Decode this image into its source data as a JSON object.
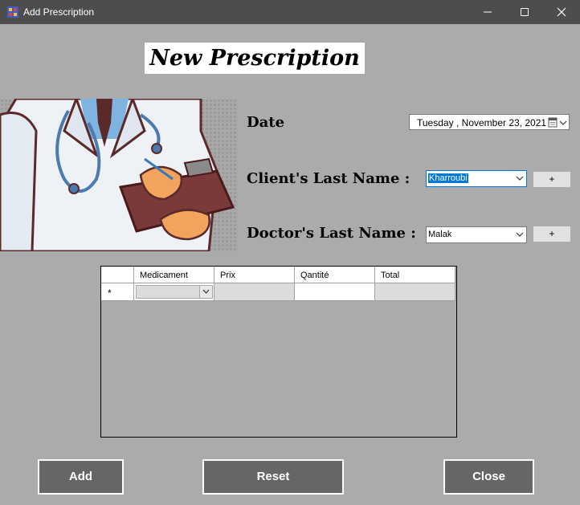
{
  "window": {
    "title": "Add Prescription",
    "controls": {
      "minimize": "minimize-icon",
      "maximize": "maximize-icon",
      "close": "close-icon"
    }
  },
  "header": {
    "title": "New Prescription"
  },
  "form": {
    "date_label": "Date",
    "date_day": "Tuesday",
    "date_value": ", November 23, 2021",
    "client_label": "Client's Last Name :",
    "client_value": "Kharroubi",
    "client_add": "+",
    "doctor_label": "Doctor's Last Name :",
    "doctor_value": "Malak",
    "doctor_add": "+"
  },
  "grid": {
    "columns": [
      "Medicament",
      "Prix",
      "Qantité",
      "Total"
    ],
    "new_row_marker": "*",
    "rows": [
      {
        "medicament": "",
        "prix": "",
        "quantite": "",
        "total": ""
      }
    ]
  },
  "actions": {
    "add": "Add",
    "reset": "Reset",
    "close": "Close"
  },
  "colors": {
    "background": "#ababab",
    "titlebar": "#4d4d4d",
    "button": "#666666",
    "accent": "#0078d7"
  }
}
